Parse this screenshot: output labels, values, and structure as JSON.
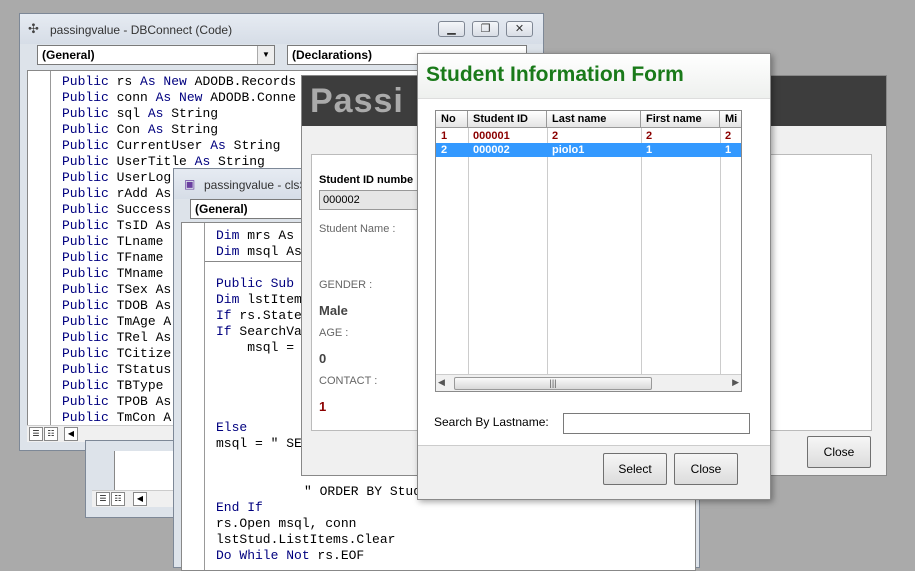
{
  "code_window": {
    "title": "passingvalue - DBConnect (Code)",
    "object_combo": "(General)",
    "proc_combo": "(Declarations)",
    "lines": [
      [
        "Public",
        " rs ",
        "As New",
        " ADODB.Records"
      ],
      [
        "Public",
        " conn ",
        "As New",
        " ADODB.Conne"
      ],
      [
        "Public",
        " sql ",
        "As",
        " String"
      ],
      [
        "Public",
        " Con ",
        "As",
        " String"
      ],
      [
        "Public",
        " CurrentUser ",
        "As",
        " String"
      ],
      [
        "Public",
        " UserTitle ",
        "As",
        " String"
      ],
      [
        "Public",
        " UserLog",
        "",
        ""
      ],
      [
        "Public",
        " rAdd As",
        "",
        ""
      ],
      [
        "Public",
        " Success",
        "",
        ""
      ],
      [
        "Public",
        " TsID As",
        "",
        ""
      ],
      [
        "Public",
        " TLname",
        "",
        ""
      ],
      [
        "Public",
        " TFname",
        "",
        ""
      ],
      [
        "Public",
        " TMname",
        "",
        ""
      ],
      [
        "Public",
        " TSex As",
        "",
        ""
      ],
      [
        "Public",
        " TDOB As",
        "",
        ""
      ],
      [
        "Public",
        " TmAge A",
        "",
        ""
      ],
      [
        "Public",
        " TRel As",
        "",
        ""
      ],
      [
        "Public",
        " TCitize",
        "",
        ""
      ],
      [
        "Public",
        " TStatus",
        "",
        ""
      ],
      [
        "Public",
        " TBType",
        "",
        ""
      ],
      [
        "Public",
        " TPOB As",
        "",
        ""
      ],
      [
        "Public",
        " TmCon A",
        "",
        ""
      ]
    ]
  },
  "class_window": {
    "title": "passingvalue - clsS",
    "object_combo": "(General)",
    "lines_top": [
      [
        "Dim",
        " mrs As"
      ],
      [
        "Dim",
        " msql As"
      ]
    ],
    "lines_mid": [
      [
        "Public Sub",
        ""
      ],
      [
        "Dim",
        " lstItem"
      ],
      [
        "If",
        " rs.State"
      ],
      [
        "If",
        " SearchVa"
      ],
      [
        "",
        "    msql ="
      ]
    ],
    "lines_else": [
      [
        "Else",
        ""
      ],
      [
        "",
        "msql = \" SE"
      ]
    ],
    "line_order": "\" ORDER BY Stud",
    "lines_bottom": [
      [
        "End If",
        ""
      ],
      [
        "",
        "rs.Open msql, conn"
      ],
      [
        "",
        "lstStud.ListItems.Clear"
      ],
      [
        "Do While Not",
        " rs.EOF"
      ]
    ]
  },
  "passing_window": {
    "banner": "Passi",
    "student_id_label": "Student ID numbe",
    "student_id_value": "000002",
    "student_name_label": "Student Name :",
    "gender_label": "GENDER :",
    "gender_value": "Male",
    "age_label": "AGE :",
    "age_value": "0",
    "contact_label": "CONTACT :",
    "contact_value": "1",
    "close_label": "Close"
  },
  "student_form": {
    "title": "Student Information Form",
    "columns": [
      "No",
      "Student ID",
      "Last name",
      "First name",
      "Mi"
    ],
    "rows": [
      [
        "1",
        "000001",
        "2",
        "2",
        "2"
      ],
      [
        "2",
        "000002",
        "piolo1",
        "1",
        "1"
      ]
    ],
    "selected_row": 1,
    "search_label": "Search By Lastname:",
    "search_value": "",
    "select_label": "Select",
    "close_label": "Close",
    "colors": {
      "title": "#1a7a1a",
      "row_text": "#8b0000",
      "selection": "#3399ff"
    }
  }
}
